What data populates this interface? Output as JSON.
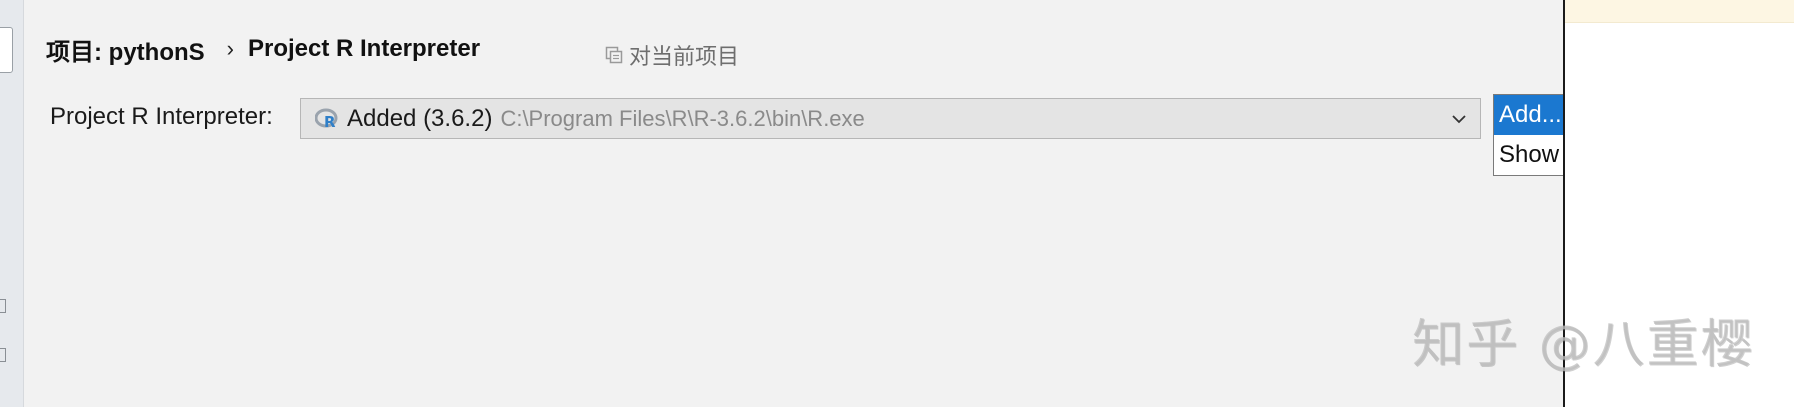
{
  "breadcrumb": {
    "project": "项目: pythonS",
    "separator": "›",
    "current": "Project R Interpreter"
  },
  "scope": {
    "icon": "copy-icon",
    "label": "对当前项目"
  },
  "interpreter": {
    "label": "Project R Interpreter:",
    "icon": "r-logo-icon",
    "selected_name": "Added (3.6.2)",
    "selected_path": "C:\\Program Files\\R\\R-3.6.2\\bin\\R.exe"
  },
  "menu": {
    "items": [
      {
        "label": "Add...",
        "selected": true
      },
      {
        "label": "Show all...",
        "selected": false
      }
    ]
  },
  "watermark": "知乎 @八重樱",
  "colors": {
    "accent": "#1b78d0",
    "panel_bg": "#f2f2f2",
    "combo_bg": "#e4e4e4"
  }
}
